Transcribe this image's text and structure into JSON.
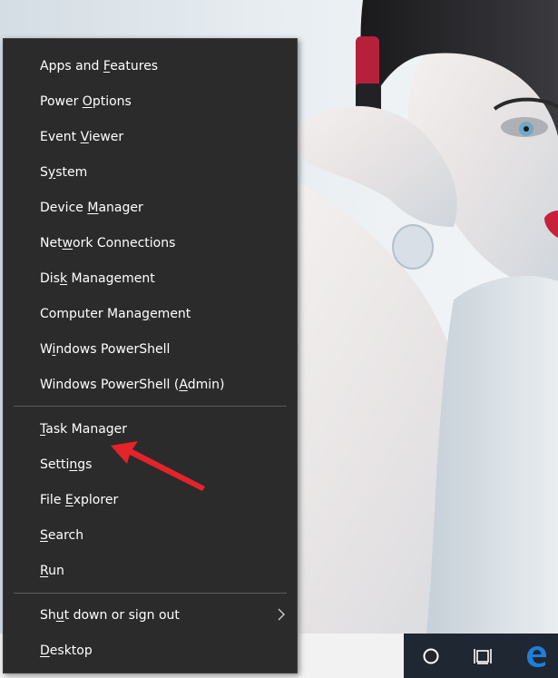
{
  "menu": {
    "items": [
      {
        "pre": "Apps and ",
        "key": "F",
        "post": "eatures"
      },
      {
        "pre": "Power ",
        "key": "O",
        "post": "ptions"
      },
      {
        "pre": "Event ",
        "key": "V",
        "post": "iewer"
      },
      {
        "pre": "S",
        "key": "y",
        "post": "stem"
      },
      {
        "pre": "Device ",
        "key": "M",
        "post": "anager"
      },
      {
        "pre": "Net",
        "key": "w",
        "post": "ork Connections"
      },
      {
        "pre": "Dis",
        "key": "k",
        "post": " Management"
      },
      {
        "pre": "Computer Mana",
        "key": "g",
        "post": "ement"
      },
      {
        "pre": "W",
        "key": "i",
        "post": "ndows PowerShell"
      },
      {
        "pre": "Windows PowerShell (",
        "key": "A",
        "post": "dmin)"
      },
      {
        "pre": "",
        "key": "T",
        "post": "ask Manager"
      },
      {
        "pre": "Setti",
        "key": "n",
        "post": "gs"
      },
      {
        "pre": "File ",
        "key": "E",
        "post": "xplorer"
      },
      {
        "pre": "",
        "key": "S",
        "post": "earch"
      },
      {
        "pre": "",
        "key": "R",
        "post": "un"
      },
      {
        "pre": "Sh",
        "key": "u",
        "post": "t down or sign out"
      },
      {
        "pre": "",
        "key": "D",
        "post": "esktop"
      }
    ]
  },
  "icons": {
    "submenu": "chevron-right-icon",
    "cortana": "cortana-circle-icon",
    "task_view": "task-view-icon",
    "edge": "edge-icon"
  },
  "colors": {
    "menu_bg": "#2b2b2b",
    "menu_text": "#ffffff",
    "separator": "#5a5a5a",
    "taskbar": "#1f2733",
    "edge_blue": "#1e7fd8",
    "annotation_red": "#e5232b"
  }
}
